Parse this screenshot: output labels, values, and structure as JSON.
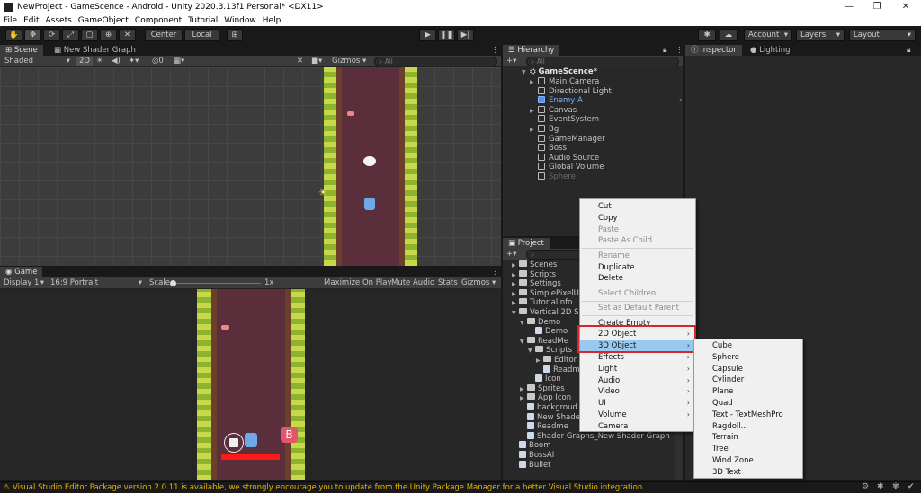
{
  "window": {
    "title": "NewProject - GameScence - Android - Unity 2020.3.13f1 Personal* <DX11>",
    "controls": [
      "—",
      "❐",
      "✕"
    ]
  },
  "menubar": [
    "File",
    "Edit",
    "Assets",
    "GameObject",
    "Component",
    "Tutorial",
    "Window",
    "Help"
  ],
  "toolbar": {
    "center_label": "Center",
    "local_label": "Local",
    "account_label": "Account",
    "layers_label": "Layers",
    "layout_label": "Layout"
  },
  "scene_panel": {
    "tabs": [
      "Scene",
      "New Shader Graph"
    ],
    "shading": "Shaded",
    "mode_2d": "2D",
    "fx_count": "0",
    "gizmos": "Gizmos",
    "search_placeholder": "All"
  },
  "game_panel": {
    "tab": "Game",
    "display": "Display 1",
    "aspect": "16:9 Portrait",
    "scale_label": "Scale",
    "scale_value": "1x",
    "maximize": "Maximize On Play",
    "mute": "Mute Audio",
    "stats": "Stats",
    "gizmos": "Gizmos",
    "boss_button": "B"
  },
  "hierarchy": {
    "tab": "Hierarchy",
    "search_placeholder": "All",
    "scene": "GameScence*",
    "items": [
      {
        "label": "Main Camera",
        "expand": true
      },
      {
        "label": "Directional Light",
        "expand": false
      },
      {
        "label": "Enemy A",
        "expand": false,
        "prefab": true
      },
      {
        "label": "Canvas",
        "expand": true
      },
      {
        "label": "EventSystem",
        "expand": false
      },
      {
        "label": "Bg",
        "expand": true
      },
      {
        "label": "GameManager",
        "expand": false
      },
      {
        "label": "Boss",
        "expand": false
      },
      {
        "label": "Audio Source",
        "expand": false
      },
      {
        "label": "Global Volume",
        "expand": false
      },
      {
        "label": "Sphere",
        "expand": false,
        "disabled": true
      }
    ]
  },
  "inspector": {
    "tab_inspector": "Inspector",
    "tab_lighting": "Lighting"
  },
  "project": {
    "tab": "Project",
    "items": [
      {
        "label": "Scenes",
        "indent": 0,
        "kind": "folder",
        "arrow": "▶"
      },
      {
        "label": "Scripts",
        "indent": 0,
        "kind": "folder",
        "arrow": "▶"
      },
      {
        "label": "Settings",
        "indent": 0,
        "kind": "folder",
        "arrow": "▶"
      },
      {
        "label": "SimplePixelUI",
        "indent": 0,
        "kind": "folder",
        "arrow": "▶"
      },
      {
        "label": "TutorialInfo",
        "indent": 0,
        "kind": "folder",
        "arrow": "▶"
      },
      {
        "label": "Vertical 2D Sh",
        "indent": 0,
        "kind": "folder",
        "arrow": "▼"
      },
      {
        "label": "Demo",
        "indent": 1,
        "kind": "folder",
        "arrow": "▼"
      },
      {
        "label": "Demo",
        "indent": 2,
        "kind": "asset",
        "arrow": ""
      },
      {
        "label": "ReadMe",
        "indent": 1,
        "kind": "folder",
        "arrow": "▼"
      },
      {
        "label": "Scripts",
        "indent": 2,
        "kind": "folder",
        "arrow": "▼"
      },
      {
        "label": "Editor",
        "indent": 3,
        "kind": "folder",
        "arrow": "▶"
      },
      {
        "label": "Readm",
        "indent": 3,
        "kind": "asset",
        "arrow": ""
      },
      {
        "label": "Icon",
        "indent": 2,
        "kind": "asset",
        "arrow": ""
      },
      {
        "label": "Sprites",
        "indent": 1,
        "kind": "folder",
        "arrow": "▶"
      },
      {
        "label": "App Icon",
        "indent": 1,
        "kind": "folder",
        "arrow": "▶"
      },
      {
        "label": "backgroud",
        "indent": 1,
        "kind": "asset",
        "arrow": ""
      },
      {
        "label": "New Shade",
        "indent": 1,
        "kind": "asset",
        "arrow": ""
      },
      {
        "label": "Readme",
        "indent": 1,
        "kind": "asset",
        "arrow": ""
      },
      {
        "label": "Shader Graphs_New Shader Graph",
        "indent": 1,
        "kind": "asset",
        "arrow": ""
      },
      {
        "label": "Boom",
        "indent": 0,
        "kind": "asset",
        "arrow": ""
      },
      {
        "label": "BossAI",
        "indent": 0,
        "kind": "asset",
        "arrow": ""
      },
      {
        "label": "Bullet",
        "indent": 0,
        "kind": "asset",
        "arrow": ""
      }
    ]
  },
  "context_menu": {
    "items": [
      {
        "label": "Cut",
        "disabled": false
      },
      {
        "label": "Copy",
        "disabled": false
      },
      {
        "label": "Paste",
        "disabled": true
      },
      {
        "label": "Paste As Child",
        "disabled": true
      },
      {
        "sep": true
      },
      {
        "label": "Rename",
        "disabled": true
      },
      {
        "label": "Duplicate",
        "disabled": false
      },
      {
        "label": "Delete",
        "disabled": false
      },
      {
        "sep": true
      },
      {
        "label": "Select Children",
        "disabled": true
      },
      {
        "sep": true
      },
      {
        "label": "Set as Default Parent",
        "disabled": true
      },
      {
        "sep": true
      },
      {
        "label": "Create Empty",
        "disabled": false
      },
      {
        "label": "2D Object",
        "disabled": false,
        "submenu": true
      },
      {
        "label": "3D Object",
        "disabled": false,
        "submenu": true,
        "highlight": true
      },
      {
        "label": "Effects",
        "disabled": false,
        "submenu": true
      },
      {
        "label": "Light",
        "disabled": false,
        "submenu": true
      },
      {
        "label": "Audio",
        "disabled": false,
        "submenu": true
      },
      {
        "label": "Video",
        "disabled": false,
        "submenu": true
      },
      {
        "label": "UI",
        "disabled": false,
        "submenu": true
      },
      {
        "label": "Volume",
        "disabled": false,
        "submenu": true
      },
      {
        "label": "Camera",
        "disabled": false
      }
    ],
    "submenu_3d": [
      "Cube",
      "Sphere",
      "Capsule",
      "Cylinder",
      "Plane",
      "Quad",
      "Text - TextMeshPro",
      "Ragdoll...",
      "Terrain",
      "Tree",
      "Wind Zone",
      "3D Text"
    ]
  },
  "status": {
    "message": "Visual Studio Editor Package version 2.0.11 is available, we strongly encourage you to update from the Unity Package Manager for a better Visual Studio integration"
  },
  "colors": {
    "highlight_box": "#d6262e",
    "menu_highlight": "#99c9ef",
    "prefab_blue": "#7fb2ff",
    "road": "#5a2e3a",
    "grass": "#a6c53e"
  }
}
